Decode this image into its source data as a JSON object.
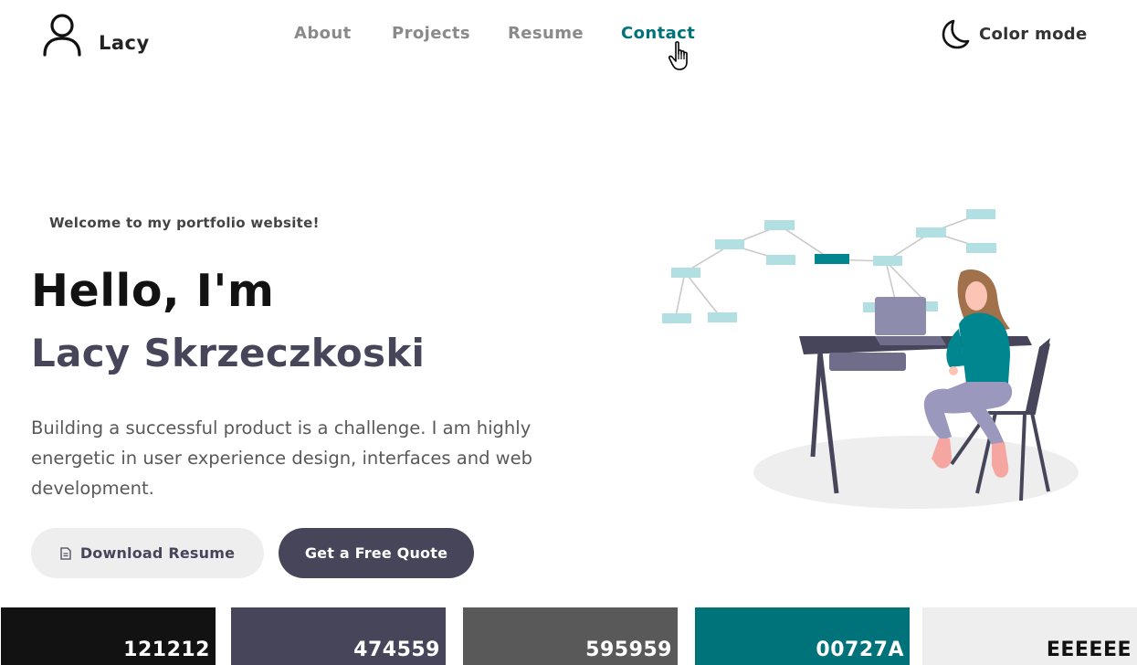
{
  "brand": {
    "name": "Lacy",
    "icon": "user-icon"
  },
  "nav": {
    "items": [
      "About",
      "Projects",
      "Resume",
      "Contact"
    ],
    "active": "Contact"
  },
  "color_mode": {
    "label": "Color mode",
    "icon": "moon-icon"
  },
  "hero": {
    "welcome": "Welcome to my portfolio website!",
    "greeting": "Hello, I'm",
    "name": "Lacy Skrzeczkoski",
    "description": "Building a successful product is a challenge. I am highly energetic in user experience design, interfaces and web development.",
    "buttons": {
      "resume": "Download Resume",
      "quote": "Get a Free Quote"
    }
  },
  "palette": [
    {
      "label": "121212",
      "color": "#121212",
      "text_color": "#ffffff"
    },
    {
      "label": "474559",
      "color": "#474559",
      "text_color": "#ffffff"
    },
    {
      "label": "595959",
      "color": "#595959",
      "text_color": "#ffffff"
    },
    {
      "label": "00727A",
      "color": "#00727A",
      "text_color": "#ffffff"
    },
    {
      "label": "EEEEEE",
      "color": "#EEEEEE",
      "text_color": "#121212"
    }
  ]
}
